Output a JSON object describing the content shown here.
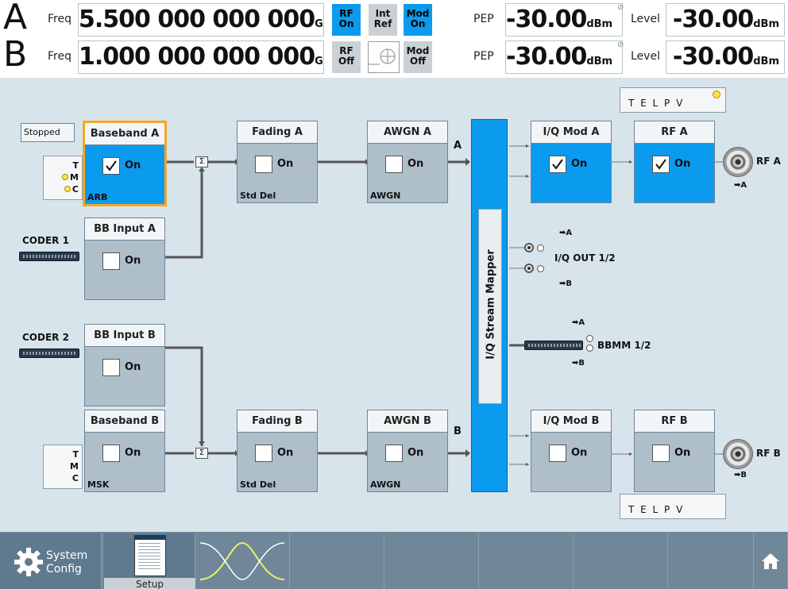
{
  "header": {
    "path_a": {
      "letter": "A",
      "freq_label": "Freq",
      "freq_value": "5.500 000 000 000",
      "freq_unit": "GHz",
      "rf_state": "RF\nOn",
      "ref_state": "Int\nRef",
      "mod_state": "Mod\nOn",
      "pep_label": "PEP",
      "pep_value": "-30.00",
      "pep_unit": "dBm",
      "level_label": "Level",
      "level_value": "-30.00",
      "level_unit": "dBm"
    },
    "path_b": {
      "letter": "B",
      "freq_label": "Freq",
      "freq_value": "1.000 000 000 000",
      "freq_unit": "GHz",
      "rf_state": "RF\nOff",
      "mod_state": "Mod\nOff",
      "pep_label": "PEP",
      "pep_value": "-30.00",
      "pep_unit": "dBm",
      "level_label": "Level",
      "level_value": "-30.00",
      "level_unit": "dBm"
    },
    "colors": {
      "on_indicator": "#0a9bef",
      "off_indicator": "#c9d1d6"
    }
  },
  "diagram": {
    "stopped_label": "Stopped",
    "tmc_a": {
      "t": "T",
      "m": "M",
      "c": "C"
    },
    "tmc_b": {
      "t": "T",
      "m": "M",
      "c": "C"
    },
    "coder1": "CODER 1",
    "coder2": "CODER 2",
    "blocks": {
      "baseband_a": {
        "title": "Baseband A",
        "state": "On",
        "sub": "ARB",
        "checked": true
      },
      "bb_input_a": {
        "title": "BB Input A",
        "state": "On",
        "checked": false
      },
      "bb_input_b": {
        "title": "BB Input B",
        "state": "On",
        "checked": false
      },
      "baseband_b": {
        "title": "Baseband B",
        "state": "On",
        "sub": "MSK",
        "checked": false
      },
      "fading_a": {
        "title": "Fading A",
        "state": "On",
        "sub": "Std Del",
        "checked": false
      },
      "fading_b": {
        "title": "Fading B",
        "state": "On",
        "sub": "Std Del",
        "checked": false
      },
      "awgn_a": {
        "title": "AWGN A",
        "state": "On",
        "sub": "AWGN",
        "checked": false
      },
      "awgn_b": {
        "title": "AWGN B",
        "state": "On",
        "sub": "AWGN",
        "checked": false
      },
      "iq_mod_a": {
        "title": "I/Q Mod A",
        "state": "On",
        "checked": true
      },
      "iq_mod_b": {
        "title": "I/Q Mod B",
        "state": "On",
        "checked": false
      },
      "rf_a": {
        "title": "RF A",
        "state": "On",
        "checked": true
      },
      "rf_b": {
        "title": "RF B",
        "state": "On",
        "checked": false
      }
    },
    "path_a_mark": "A",
    "path_b_mark": "B",
    "mapper_label": "I/Q Stream Mapper",
    "iq_out_label": "I/Q OUT 1/2",
    "bbmm_label": "BBMM 1/2",
    "arrow_a": "➡A",
    "arrow_b": "➡B",
    "rf_a_label": "RF A",
    "rf_b_label": "RF B",
    "telpv": "T E L P V",
    "sigma": "Σ"
  },
  "taskbar": {
    "system_config": "System\nConfig",
    "setup": "Setup"
  }
}
